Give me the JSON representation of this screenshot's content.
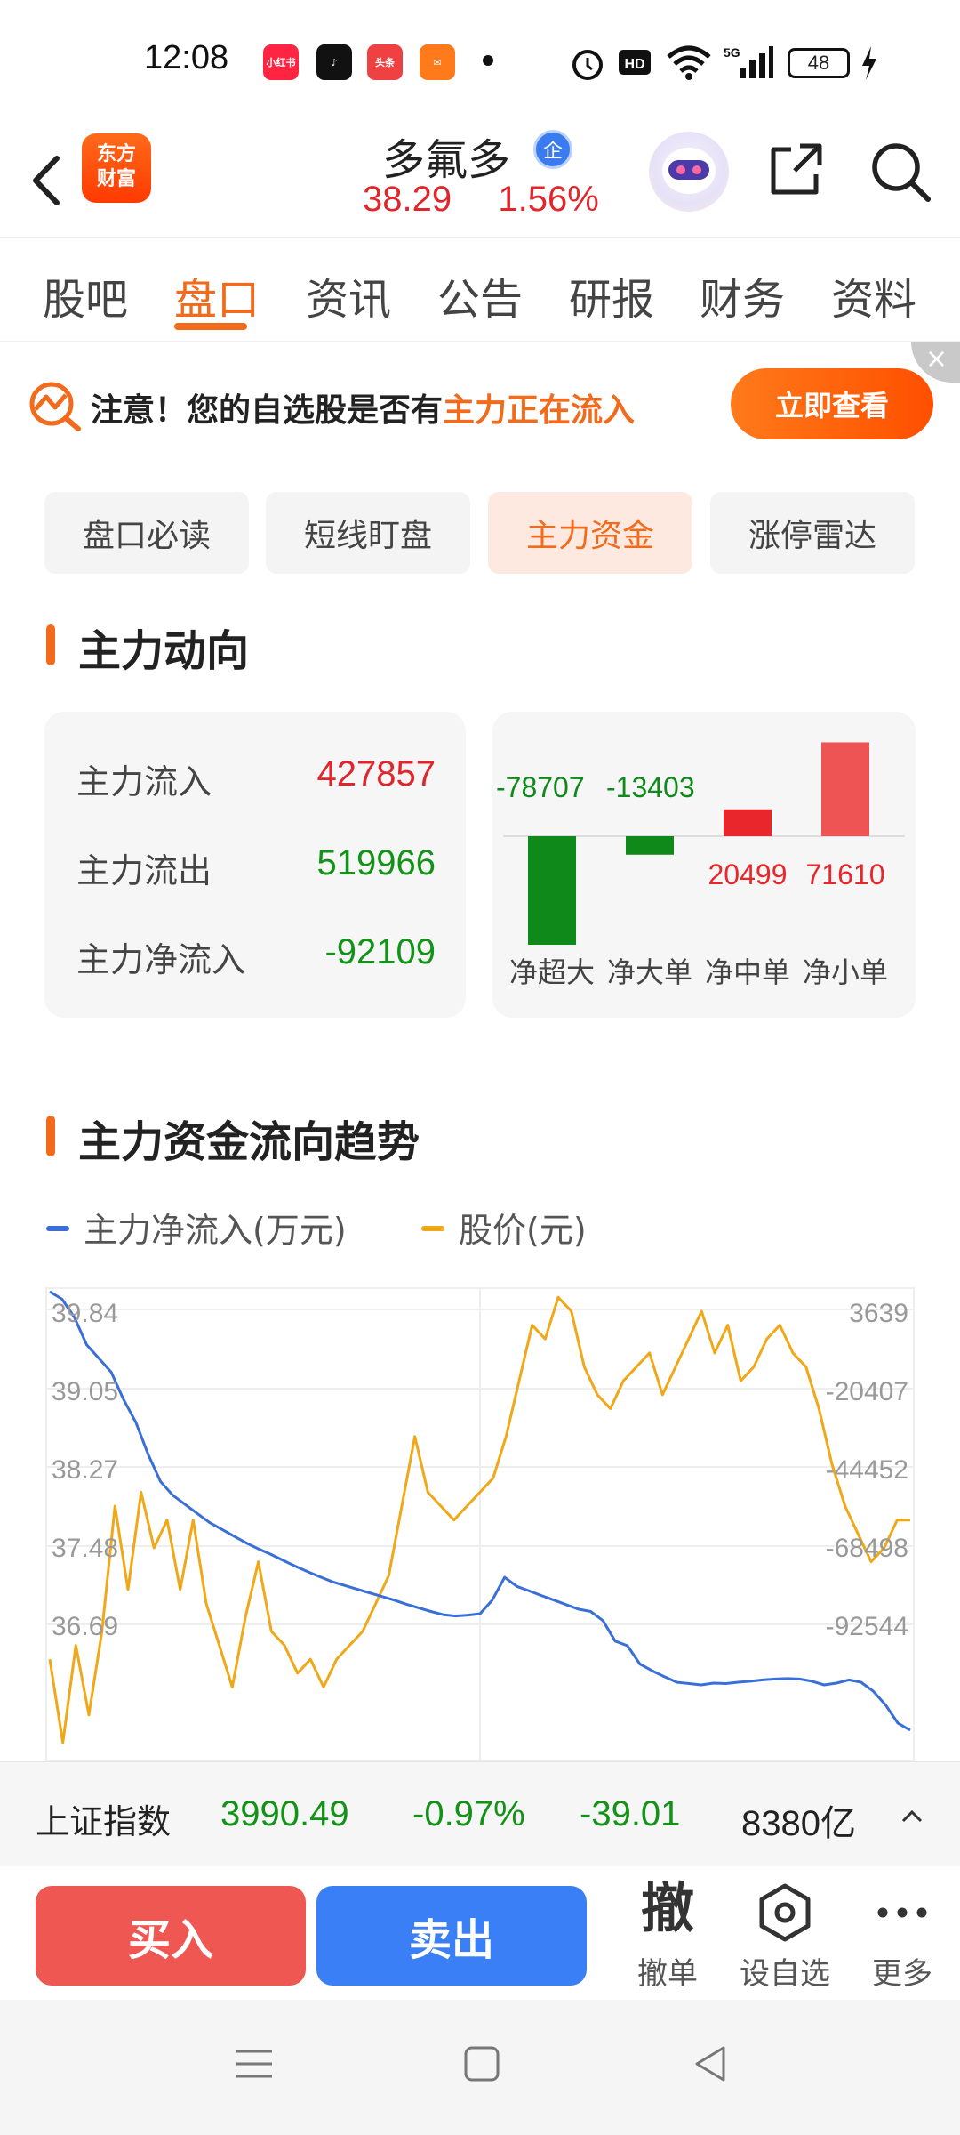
{
  "status_bar": {
    "time": "12:08",
    "apps": [
      {
        "name": "xiaohongshu",
        "label": "小红书",
        "color": "#ff2442"
      },
      {
        "name": "tiktok",
        "label": "♪",
        "color": "#111111"
      },
      {
        "name": "toutiao",
        "label": "头条",
        "color": "#f04142"
      },
      {
        "name": "app-orange",
        "label": "✉",
        "color": "#ff7a1a"
      }
    ],
    "network": "5G",
    "battery": "48"
  },
  "header": {
    "logo_text": "东方财富",
    "stock_name": "多氟多",
    "enterprise_badge": "企",
    "price": "38.29",
    "change_pct": "1.56%"
  },
  "tabs": [
    "股吧",
    "盘口",
    "资讯",
    "公告",
    "研报",
    "财务",
    "资料"
  ],
  "active_tab": "盘口",
  "notice": {
    "prefix": "注意！您的自选股是否有",
    "highlight": "主力正在流入",
    "button": "立即查看",
    "close": "×"
  },
  "subtabs": [
    "盘口必读",
    "短线盯盘",
    "主力资金",
    "涨停雷达"
  ],
  "active_subtab": "主力资金",
  "main_flow": {
    "title": "主力动向",
    "rows": [
      {
        "label": "主力流入",
        "value": "427857",
        "color": "red"
      },
      {
        "label": "主力流出",
        "value": "519966",
        "color": "green"
      },
      {
        "label": "主力净流入",
        "value": "-92109",
        "color": "green"
      }
    ]
  },
  "chart_data": [
    {
      "type": "bar",
      "categories": [
        "净超大",
        "净大单",
        "净中单",
        "净小单"
      ],
      "values": [
        -78707,
        -13403,
        20499,
        71610
      ],
      "colors": [
        "#0f8a1a",
        "#0f8a1a",
        "#e8262c",
        "#ef5455"
      ]
    },
    {
      "type": "line",
      "title": "主力资金流向趋势",
      "series": [
        {
          "name": "主力净流入(万元)",
          "color": "#3a6fd8",
          "axis": "right",
          "values": [
            3639,
            2000,
            -2000,
            -8000,
            -11000,
            -14000,
            -20000,
            -25000,
            -32000,
            -38000,
            -41000,
            -43000,
            -45000,
            -47000,
            -48500,
            -50000,
            -51500,
            -52800,
            -54000,
            -55300,
            -56600,
            -57800,
            -58900,
            -60000,
            -60800,
            -61600,
            -62400,
            -63200,
            -64000,
            -64900,
            -65700,
            -66500,
            -67200,
            -67500,
            -67300,
            -67000,
            -64000,
            -59000,
            -61000,
            -62000,
            -63000,
            -64000,
            -65000,
            -66000,
            -66500,
            -68500,
            -73000,
            -74000,
            -78000,
            -79500,
            -80800,
            -82000,
            -82300,
            -82600,
            -82200,
            -82300,
            -82000,
            -81800,
            -81500,
            -81300,
            -81200,
            -81300,
            -81800,
            -82600,
            -82200,
            -81500,
            -82000,
            -84000,
            -87000,
            -91000,
            -92544
          ]
        },
        {
          "name": "股价(元)",
          "color": "#f0a818",
          "axis": "left",
          "values": [
            37.2,
            36.6,
            37.3,
            36.8,
            37.4,
            38.3,
            37.7,
            38.4,
            38.0,
            38.2,
            37.7,
            38.2,
            37.6,
            37.3,
            37.0,
            37.5,
            37.9,
            37.4,
            37.3,
            37.1,
            37.2,
            37.0,
            37.2,
            37.3,
            37.4,
            37.6,
            37.8,
            38.3,
            38.8,
            38.4,
            38.3,
            38.2,
            38.3,
            38.4,
            38.5,
            38.8,
            39.2,
            39.6,
            39.5,
            39.8,
            39.7,
            39.3,
            39.1,
            39.0,
            39.2,
            39.3,
            39.4,
            39.1,
            39.3,
            39.5,
            39.7,
            39.4,
            39.6,
            39.2,
            39.3,
            39.5,
            39.6,
            39.4,
            39.3,
            39.0,
            38.6,
            38.3,
            38.1,
            37.9,
            38.0,
            38.2,
            38.2
          ]
        }
      ],
      "left_ticks": [
        "39.84",
        "39.05",
        "38.27",
        "37.48",
        "36.69"
      ],
      "right_ticks": [
        "3639",
        "-20407",
        "-44452",
        "-68498",
        "-92544"
      ],
      "ylim_left": [
        36.69,
        39.84
      ],
      "ylim_right": [
        -92544,
        3639
      ]
    }
  ],
  "index_bar": {
    "name": "上证指数",
    "value": "3990.49",
    "change_pct": "-0.97%",
    "change": "-39.01",
    "turnover": "8380亿"
  },
  "actions": {
    "buy": "买入",
    "sell": "卖出",
    "withdraw_glyph": "撤",
    "withdraw": "撤单",
    "watchlist": "设自选",
    "more": "更多"
  }
}
